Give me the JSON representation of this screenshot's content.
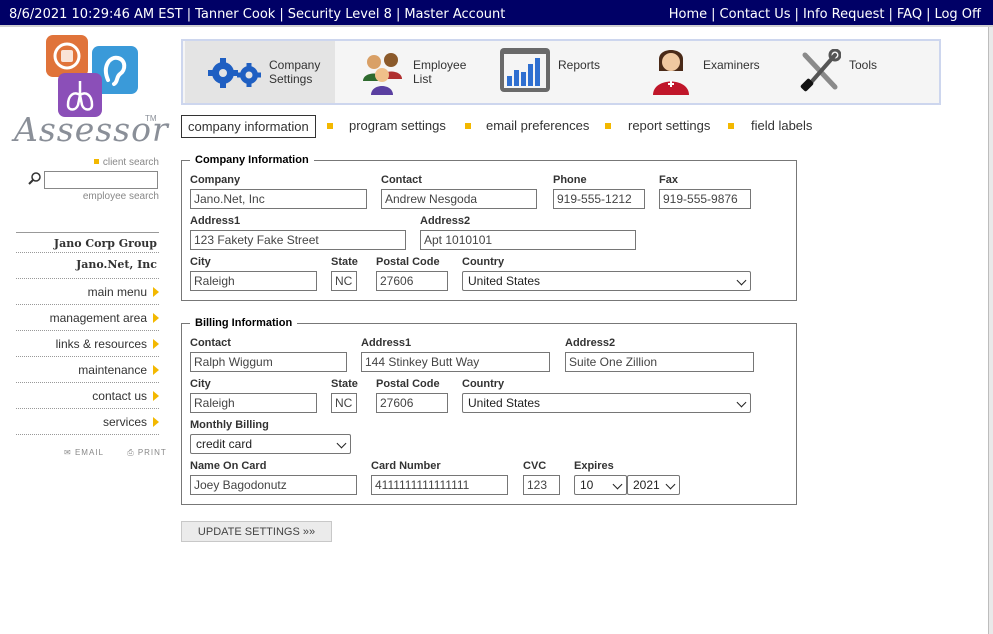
{
  "topbar": {
    "datetime": "8/6/2021 10:29:46 AM EST",
    "user": "Tanner Cook",
    "security": "Security Level 8",
    "account": "Master Account",
    "links": [
      "Home",
      "Contact Us",
      "Info Request",
      "FAQ",
      "Log Off"
    ]
  },
  "logo": {
    "text": "Assessor",
    "tm": "TM"
  },
  "search": {
    "client_label": "client search",
    "employee_label": "employee search",
    "value": ""
  },
  "sidebar": {
    "org": "Jano Corp Group",
    "company": "Jano.Net, Inc",
    "items": [
      "main menu",
      "management area",
      "links & resources",
      "maintenance",
      "contact us",
      "services"
    ],
    "email": "EMAIL",
    "print": "PRINT"
  },
  "nav": {
    "items": [
      {
        "label1": "Company",
        "label2": "Settings",
        "icon": "gears-icon"
      },
      {
        "label1": "Employee",
        "label2": "List",
        "icon": "people-icon"
      },
      {
        "label1": "Reports",
        "label2": "",
        "icon": "bar-chart-icon"
      },
      {
        "label1": "Examiners",
        "label2": "",
        "icon": "nurse-icon"
      },
      {
        "label1": "Tools",
        "label2": "",
        "icon": "tools-icon"
      }
    ]
  },
  "subtabs": [
    "company information",
    "program settings",
    "email preferences",
    "report settings",
    "field labels"
  ],
  "company_info": {
    "legend": "Company Information",
    "company_label": "Company",
    "company": "Jano.Net, Inc",
    "contact_label": "Contact",
    "contact": "Andrew Nesgoda",
    "phone_label": "Phone",
    "phone": "919-555-1212",
    "fax_label": "Fax",
    "fax": "919-555-9876",
    "address1_label": "Address1",
    "address1": "123 Fakety Fake Street",
    "address2_label": "Address2",
    "address2": "Apt 1010101",
    "city_label": "City",
    "city": "Raleigh",
    "state_label": "State",
    "state": "NC",
    "postal_label": "Postal Code",
    "postal": "27606",
    "country_label": "Country",
    "country": "United States"
  },
  "billing_info": {
    "legend": "Billing Information",
    "contact_label": "Contact",
    "contact": "Ralph Wiggum",
    "address1_label": "Address1",
    "address1": "144 Stinkey Butt Way",
    "address2_label": "Address2",
    "address2": "Suite One Zillion",
    "city_label": "City",
    "city": "Raleigh",
    "state_label": "State",
    "state": "NC",
    "postal_label": "Postal Code",
    "postal": "27606",
    "country_label": "Country",
    "country": "United States",
    "monthly_label": "Monthly Billing",
    "monthly": "credit card",
    "name_label": "Name On Card",
    "name": "Joey Bagodonutz",
    "card_label": "Card Number",
    "card": "4111111111111111",
    "cvc_label": "CVC",
    "cvc": "123",
    "expires_label": "Expires",
    "exp_month": "10",
    "exp_year": "2021"
  },
  "update_button": "UPDATE SETTINGS »»",
  "colors": {
    "topbar": "#000066",
    "accent": "#f3b800",
    "nav_border": "#cdd6ee"
  }
}
